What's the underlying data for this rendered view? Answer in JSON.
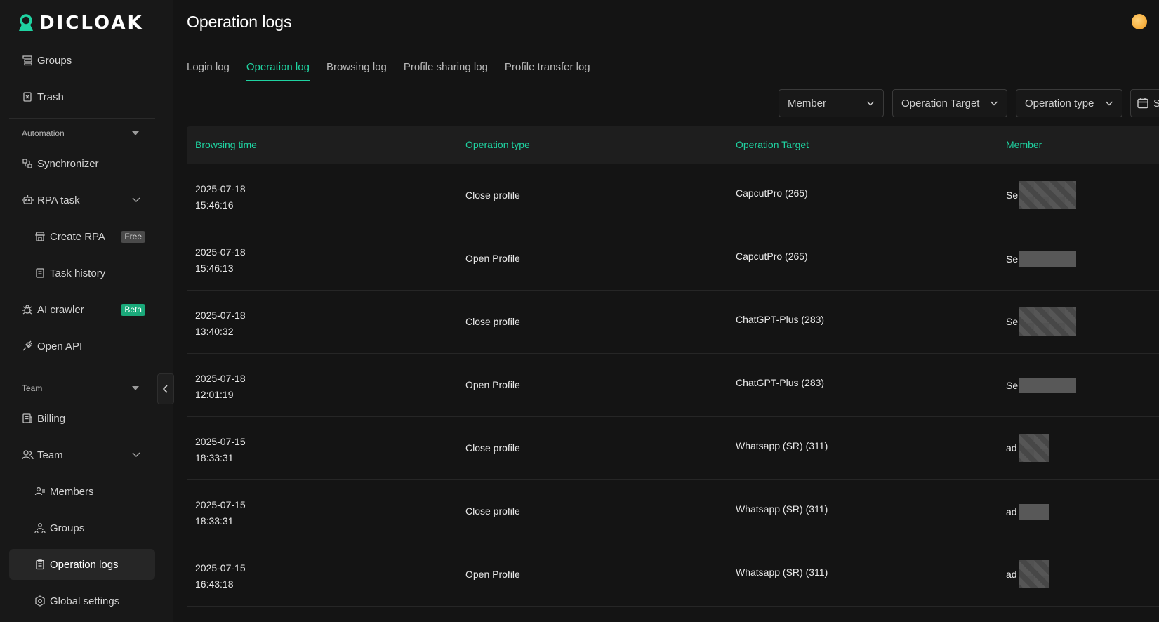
{
  "brand": {
    "name": "DICLOAK"
  },
  "sidebar": {
    "items": [
      {
        "label": "Groups",
        "icon": "groups-icon"
      },
      {
        "label": "Trash",
        "icon": "trash-icon"
      }
    ],
    "automation": {
      "label": "Automation",
      "items": [
        {
          "label": "Synchronizer",
          "icon": "synchronizer-icon"
        },
        {
          "label": "RPA task",
          "icon": "robot-icon"
        },
        {
          "label": "Create RPA",
          "icon": "store-icon",
          "badge": "Free"
        },
        {
          "label": "Task history",
          "icon": "document-icon"
        },
        {
          "label": "AI crawler",
          "icon": "bug-icon",
          "badge": "Beta"
        },
        {
          "label": "Open API",
          "icon": "plug-icon"
        }
      ]
    },
    "team": {
      "label": "Team",
      "items": [
        {
          "label": "Billing",
          "icon": "billing-icon"
        },
        {
          "label": "Team",
          "icon": "team-icon"
        },
        {
          "label": "Members",
          "icon": "members-icon"
        },
        {
          "label": "Groups",
          "icon": "team-groups-icon"
        },
        {
          "label": "Operation logs",
          "icon": "clipboard-icon"
        },
        {
          "label": "Global settings",
          "icon": "settings-icon"
        }
      ]
    }
  },
  "page": {
    "title": "Operation logs"
  },
  "tabs": [
    {
      "label": "Login log",
      "active": false
    },
    {
      "label": "Operation log",
      "active": true
    },
    {
      "label": "Browsing log",
      "active": false
    },
    {
      "label": "Profile sharing log",
      "active": false
    },
    {
      "label": "Profile transfer log",
      "active": false
    }
  ],
  "filters": {
    "member": "Member",
    "operation_target": "Operation Target",
    "operation_type": "Operation type",
    "date": "S"
  },
  "table": {
    "columns": [
      "Browsing time",
      "Operation type",
      "Operation Target",
      "Member"
    ],
    "rows": [
      {
        "date": "2025-07-18",
        "time": "15:46:16",
        "type": "Close profile",
        "target": "CapcutPro (265)",
        "member": "Se"
      },
      {
        "date": "2025-07-18",
        "time": "15:46:13",
        "type": "Open Profile",
        "target": "CapcutPro (265)",
        "member": "Se"
      },
      {
        "date": "2025-07-18",
        "time": "13:40:32",
        "type": "Close profile",
        "target": "ChatGPT-Plus (283)",
        "member": "Se"
      },
      {
        "date": "2025-07-18",
        "time": "12:01:19",
        "type": "Open Profile",
        "target": "ChatGPT-Plus (283)",
        "member": "Se"
      },
      {
        "date": "2025-07-15",
        "time": "18:33:31",
        "type": "Close profile",
        "target": "Whatsapp (SR) (311)",
        "member": "ad"
      },
      {
        "date": "2025-07-15",
        "time": "18:33:31",
        "type": "Close profile",
        "target": "Whatsapp (SR) (311)",
        "member": "ad"
      },
      {
        "date": "2025-07-15",
        "time": "16:43:18",
        "type": "Open Profile",
        "target": "Whatsapp (SR) (311)",
        "member": "ad"
      }
    ]
  },
  "colors": {
    "accent": "#1fd3a1",
    "background": "#141414",
    "sidebar": "#181818"
  }
}
